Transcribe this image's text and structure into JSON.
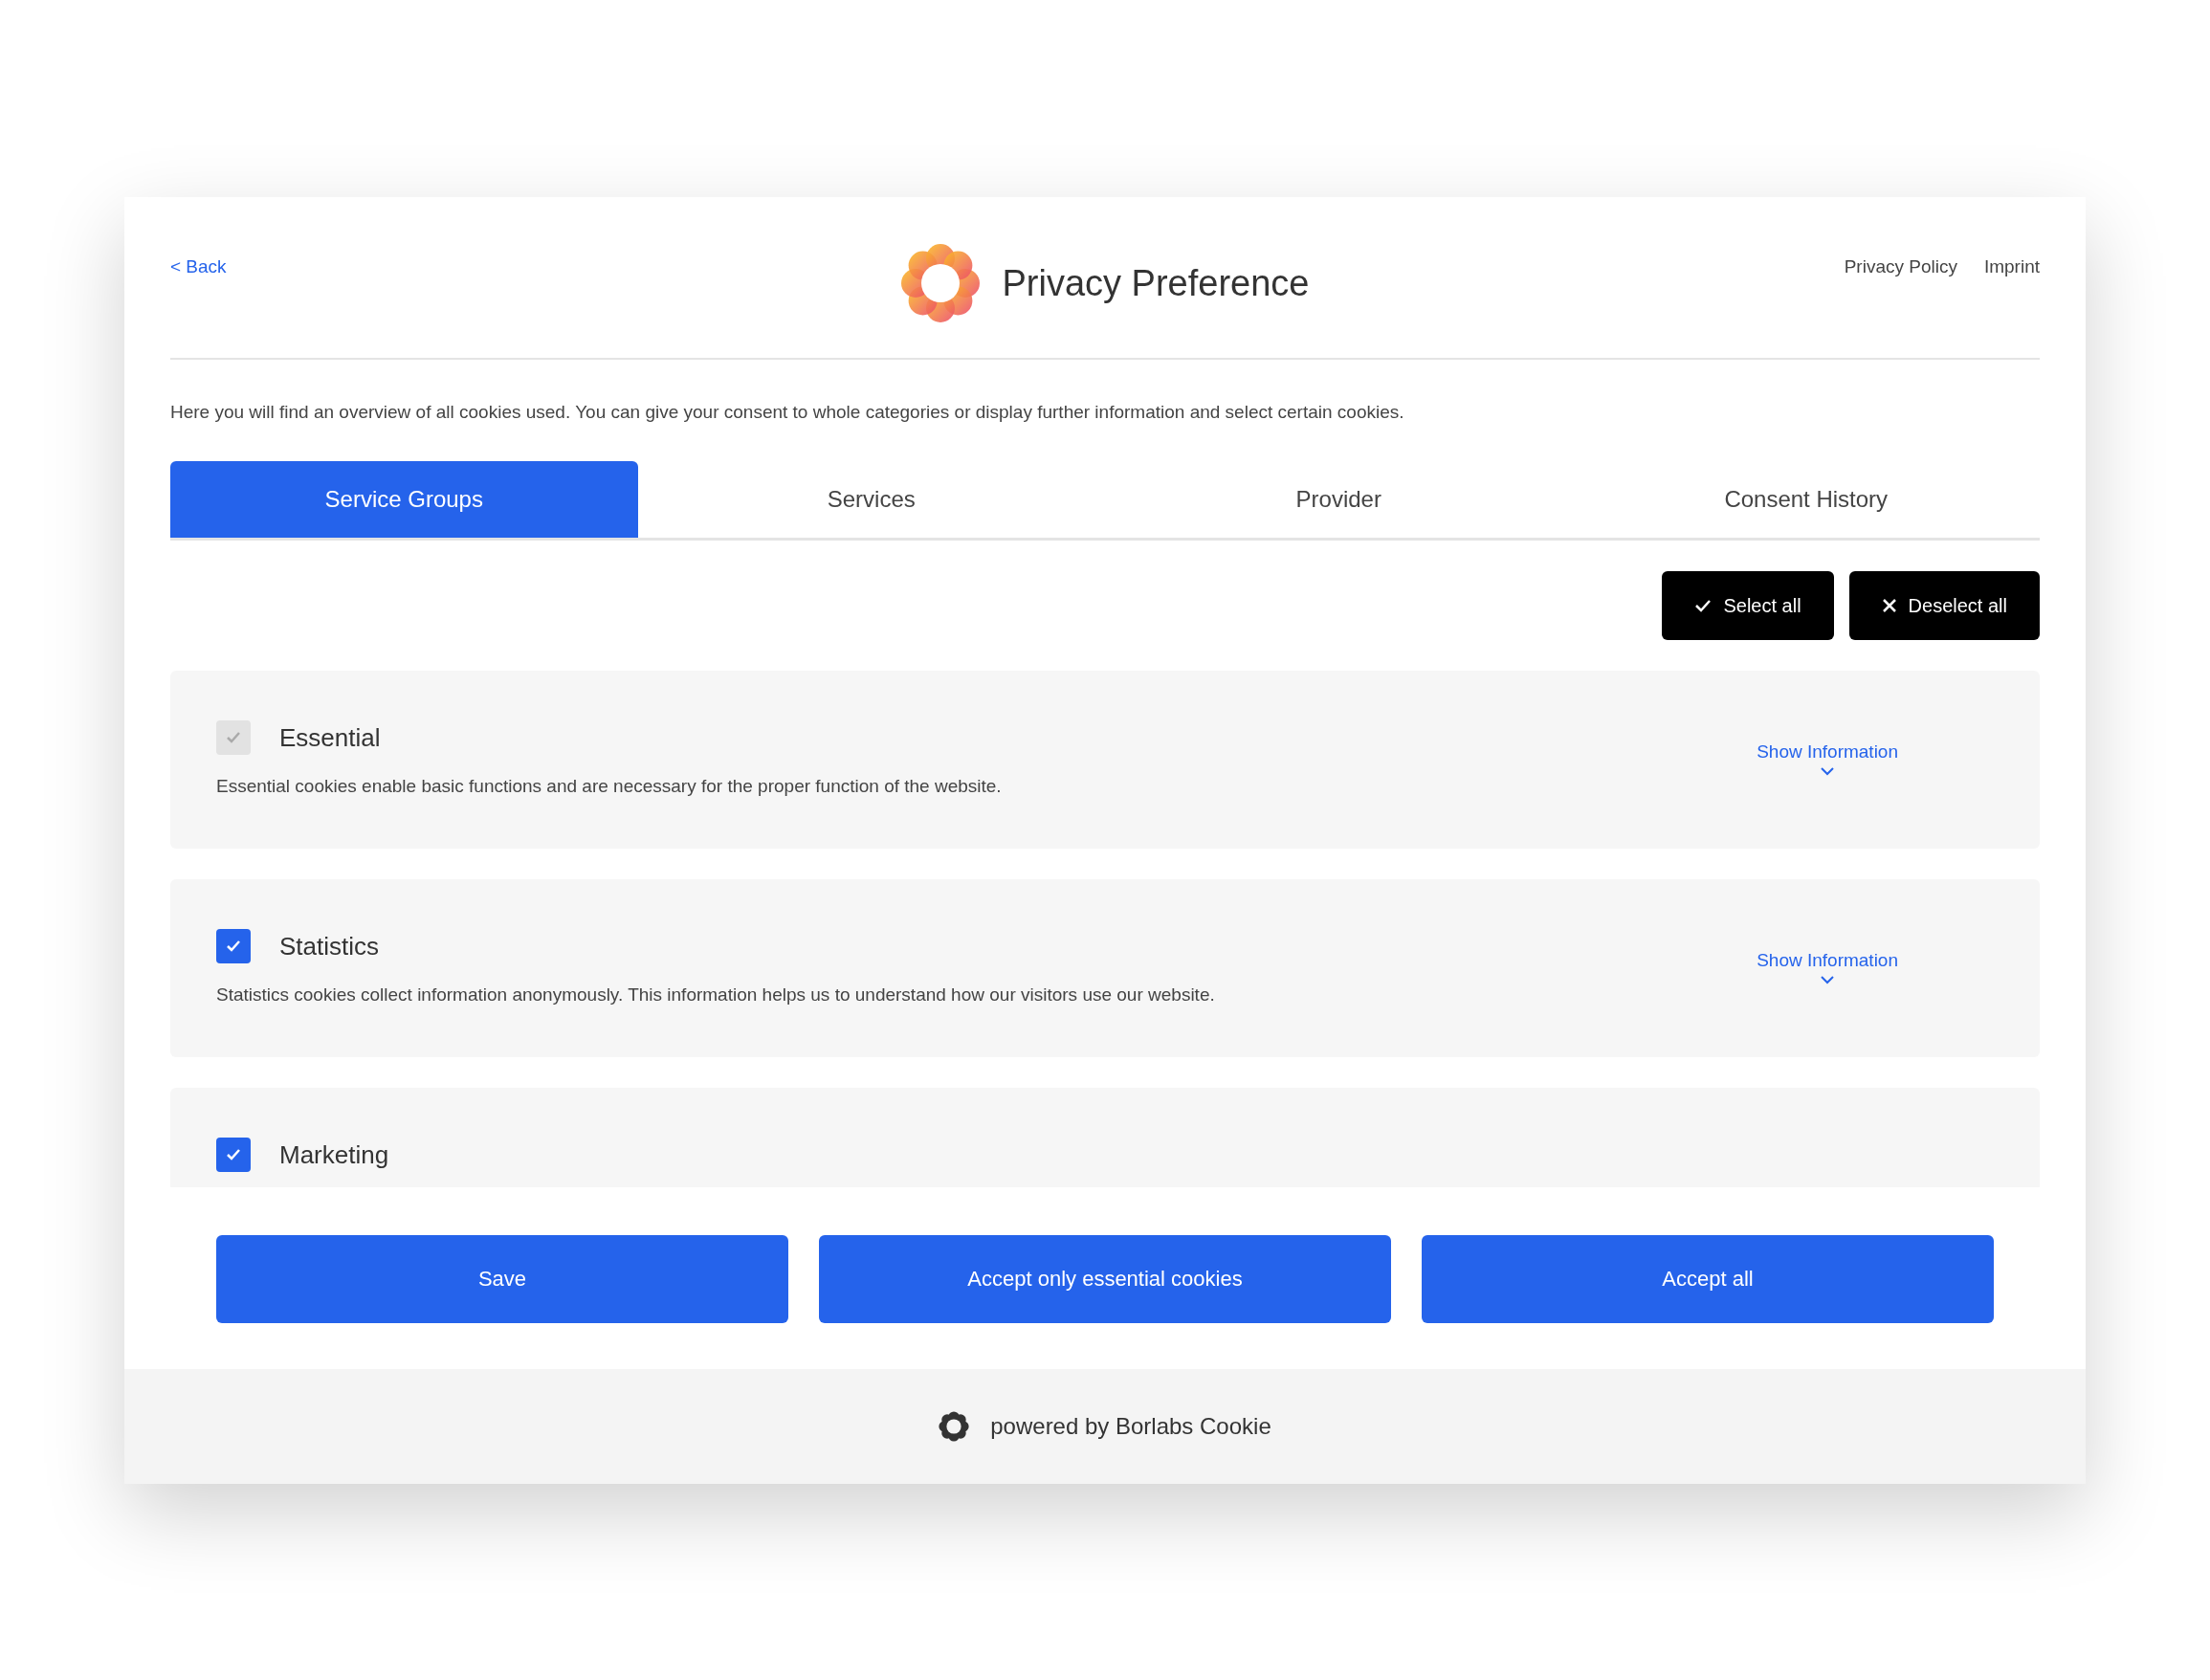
{
  "header": {
    "back_link": "< Back",
    "title": "Privacy Preference",
    "links": [
      "Privacy Policy",
      "Imprint"
    ]
  },
  "intro": "Here you will find an overview of all cookies used. You can give your consent to whole categories or display further information and select certain cookies.",
  "tabs": [
    {
      "label": "Service Groups",
      "selected": true
    },
    {
      "label": "Services",
      "selected": false
    },
    {
      "label": "Provider",
      "selected": false
    },
    {
      "label": "Consent History",
      "selected": false
    }
  ],
  "bulk_actions": [
    {
      "label": "Select all",
      "kind": "select"
    },
    {
      "label": "Deselect all",
      "kind": "deselect"
    }
  ],
  "service_groups": [
    {
      "name": "Essential",
      "checked": true,
      "disabled": true,
      "description": "Essential cookies enable basic functions and are necessary for the proper function of the website.",
      "info_link": "Show Information"
    },
    {
      "name": "Statistics",
      "checked": true,
      "disabled": false,
      "description": "Statistics cookies collect information anonymously. This information helps us to understand how our visitors use our website.",
      "info_link": "Show Information"
    },
    {
      "name": "Marketing",
      "checked": true,
      "disabled": false
    }
  ],
  "actions": [
    "Save",
    "Accept only essential cookies",
    "Accept all"
  ],
  "footer": "powered by Borlabs Cookie"
}
